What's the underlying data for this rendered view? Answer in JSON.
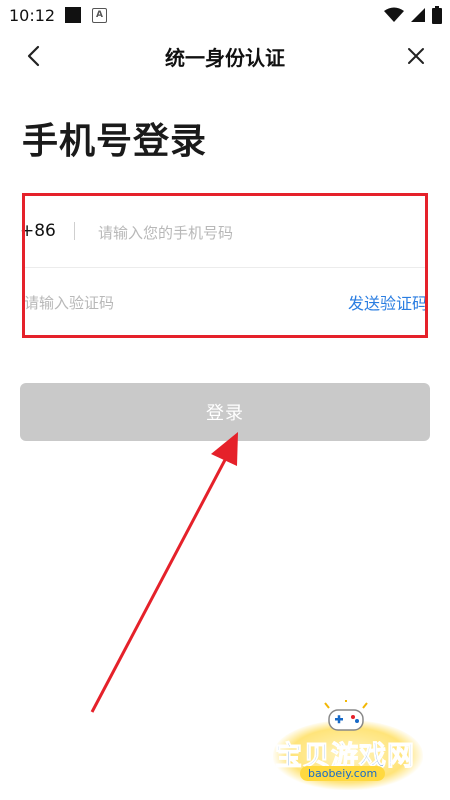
{
  "status_bar": {
    "time": "10:12",
    "icons": [
      "notification-square-icon",
      "accessibility-a-icon",
      "wifi-icon",
      "cellular-signal-icon",
      "battery-icon"
    ]
  },
  "nav": {
    "title": "统一身份认证",
    "back_icon": "chevron-left-icon",
    "close_icon": "close-icon"
  },
  "page": {
    "title": "手机号登录"
  },
  "form": {
    "country_code": "+86",
    "phone_placeholder": "请输入您的手机号码",
    "phone_value": "",
    "code_placeholder": "请输入验证码",
    "code_value": "",
    "send_code_label": "发送验证码"
  },
  "login_button": {
    "label": "登录"
  },
  "annotation": {
    "highlight_color": "#e5212a",
    "arrow_color": "#e5212a"
  },
  "watermark": {
    "title": "宝贝游戏网",
    "url": "baobeiy.com"
  },
  "colors": {
    "accent_link": "#2a7de1",
    "button_disabled": "#c9c9c9"
  }
}
